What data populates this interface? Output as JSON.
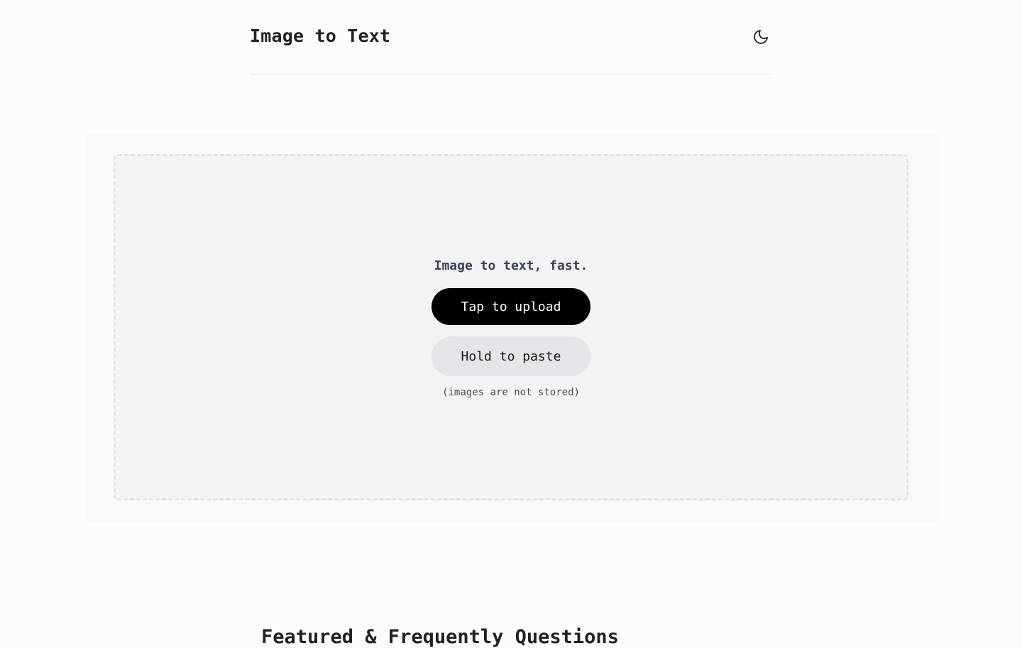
{
  "header": {
    "title": "Image to Text",
    "theme_toggle_icon": "moon-icon"
  },
  "upload": {
    "tagline": "Image to text, fast.",
    "upload_label": "Tap to upload",
    "paste_label": "Hold to paste",
    "note": "(images are not stored)"
  },
  "faq": {
    "heading": "Featured & Frequently Questions"
  },
  "colors": {
    "page_bg": "#fbfcfb",
    "primary_button": "#000000",
    "secondary_button": "#e4e5e8",
    "dropzone_bg": "#f2f3f5"
  }
}
